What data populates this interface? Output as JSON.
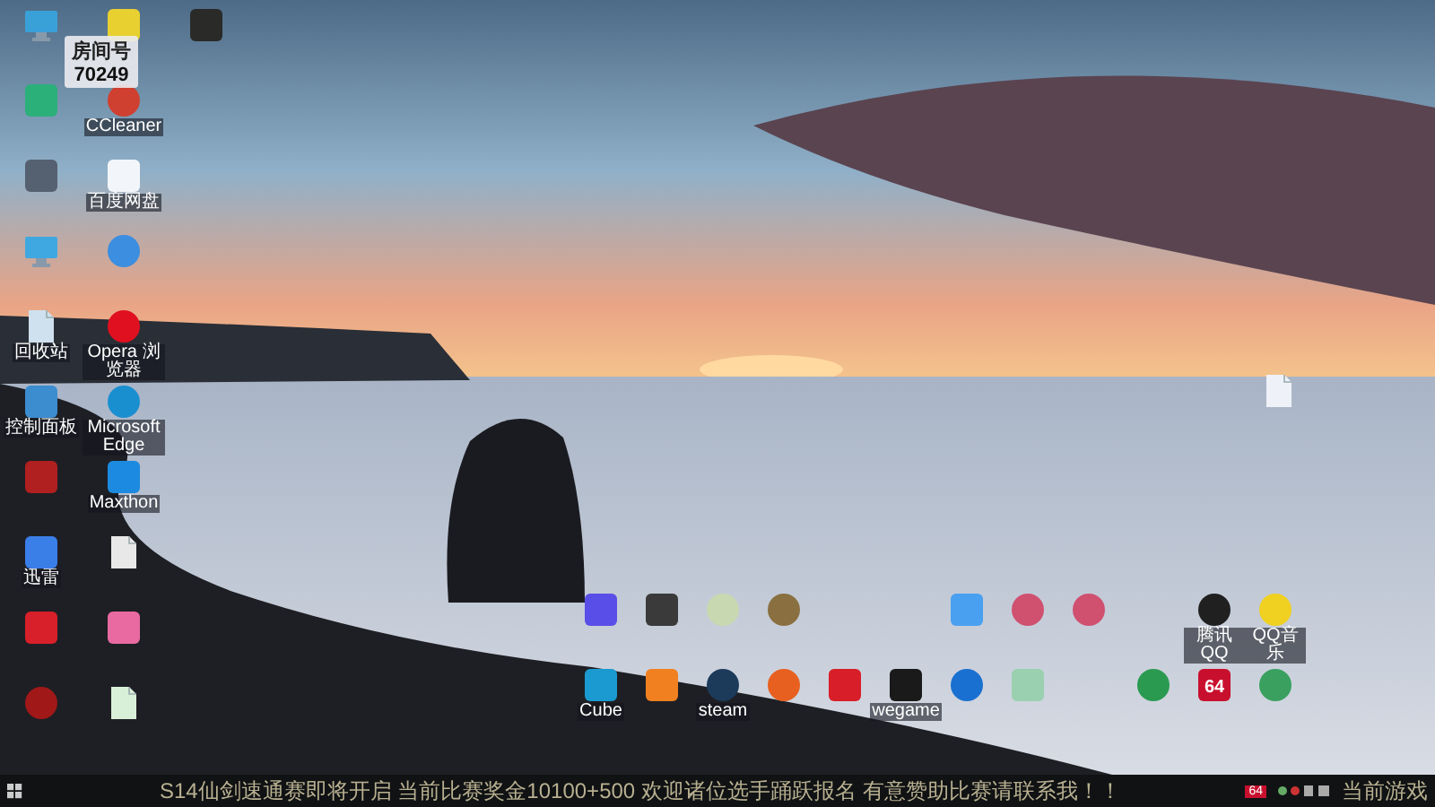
{
  "overlay": {
    "label": "房间号",
    "number": "70249"
  },
  "left_columns": [
    [
      {
        "kind": "monitor",
        "color": "#3aa0d8"
      },
      {
        "kind": "tile",
        "color": "#2bb07a"
      },
      {
        "kind": "tile",
        "color": "#556070"
      },
      {
        "kind": "monitor",
        "color": "#40a8e0"
      },
      {
        "kind": "doc",
        "color": "#cfe0ee",
        "label": "回收站"
      },
      {
        "kind": "tile",
        "color": "#3c8cd0",
        "label": "控制面板"
      },
      {
        "kind": "tile",
        "color": "#b02020"
      },
      {
        "kind": "tile",
        "color": "#3a7ee8",
        "label": "迅雷"
      },
      {
        "kind": "tile",
        "color": "#d8202a"
      },
      {
        "kind": "circle",
        "color": "#a01818"
      }
    ],
    [
      {
        "kind": "tile",
        "color": "#e8d030"
      },
      {
        "kind": "circle",
        "color": "#d04030",
        "label": "CCleaner"
      },
      {
        "kind": "tile",
        "color": "#f2f6fa",
        "label": "百度网盘"
      },
      {
        "kind": "circle",
        "color": "#3b8ee0"
      },
      {
        "kind": "circle",
        "color": "#e01020",
        "label": "Opera 浏览器"
      },
      {
        "kind": "circle",
        "color": "#1a8fd0",
        "label": "Microsoft Edge"
      },
      {
        "kind": "tile",
        "color": "#1c8ae0",
        "label": "Maxthon"
      },
      {
        "kind": "doc",
        "color": "#e8e8e8"
      },
      {
        "kind": "tile",
        "color": "#e86aa0"
      },
      {
        "kind": "doc",
        "color": "#d8f0d8"
      }
    ],
    [
      {
        "kind": "tile",
        "color": "#2a2a28"
      }
    ]
  ],
  "center_rows": [
    [
      {
        "kind": "tile",
        "color": "#5a4ee8"
      },
      {
        "kind": "tile",
        "color": "#3a3a3a"
      },
      {
        "kind": "circle",
        "color": "#c8d8b0"
      },
      {
        "kind": "circle",
        "color": "#8a7040"
      },
      null,
      null,
      {
        "kind": "tile",
        "color": "#4aa0f0"
      },
      {
        "kind": "circle",
        "color": "#d05070"
      },
      {
        "kind": "circle",
        "color": "#d05070"
      }
    ],
    [
      {
        "kind": "tile",
        "color": "#1a9ad0",
        "label": "Cube"
      },
      {
        "kind": "tile",
        "color": "#f08020"
      },
      {
        "kind": "circle",
        "color": "#1c3a5a",
        "label": "steam"
      },
      {
        "kind": "circle",
        "color": "#e86020"
      },
      {
        "kind": "tile",
        "color": "#d81e28"
      },
      {
        "kind": "tile",
        "color": "#1a1a1a",
        "label": "wegame"
      },
      {
        "kind": "circle",
        "color": "#1a70d0"
      },
      {
        "kind": "tile",
        "color": "#9ad0b0"
      }
    ]
  ],
  "right_rows": [
    [
      null,
      {
        "kind": "circle",
        "color": "#202020",
        "label": "腾讯QQ"
      },
      {
        "kind": "circle",
        "color": "#f0d020",
        "label": "QQ音乐"
      }
    ],
    [
      {
        "kind": "circle",
        "color": "#2a9a50"
      },
      {
        "kind": "tile",
        "color": "#c8102e",
        "glyph": "64"
      },
      {
        "kind": "circle",
        "color": "#3aa060"
      }
    ]
  ],
  "side_icons": [
    {
      "kind": "doc",
      "color": "#eef2f8"
    }
  ],
  "taskbar": {
    "ticker": "S14仙剑速通赛即将开启  当前比赛奖金10100+500 欢迎诸位选手踊跃报名 有意赞助比赛请联系我！！",
    "tray_badge": "64",
    "right_text": "当前游戏"
  }
}
